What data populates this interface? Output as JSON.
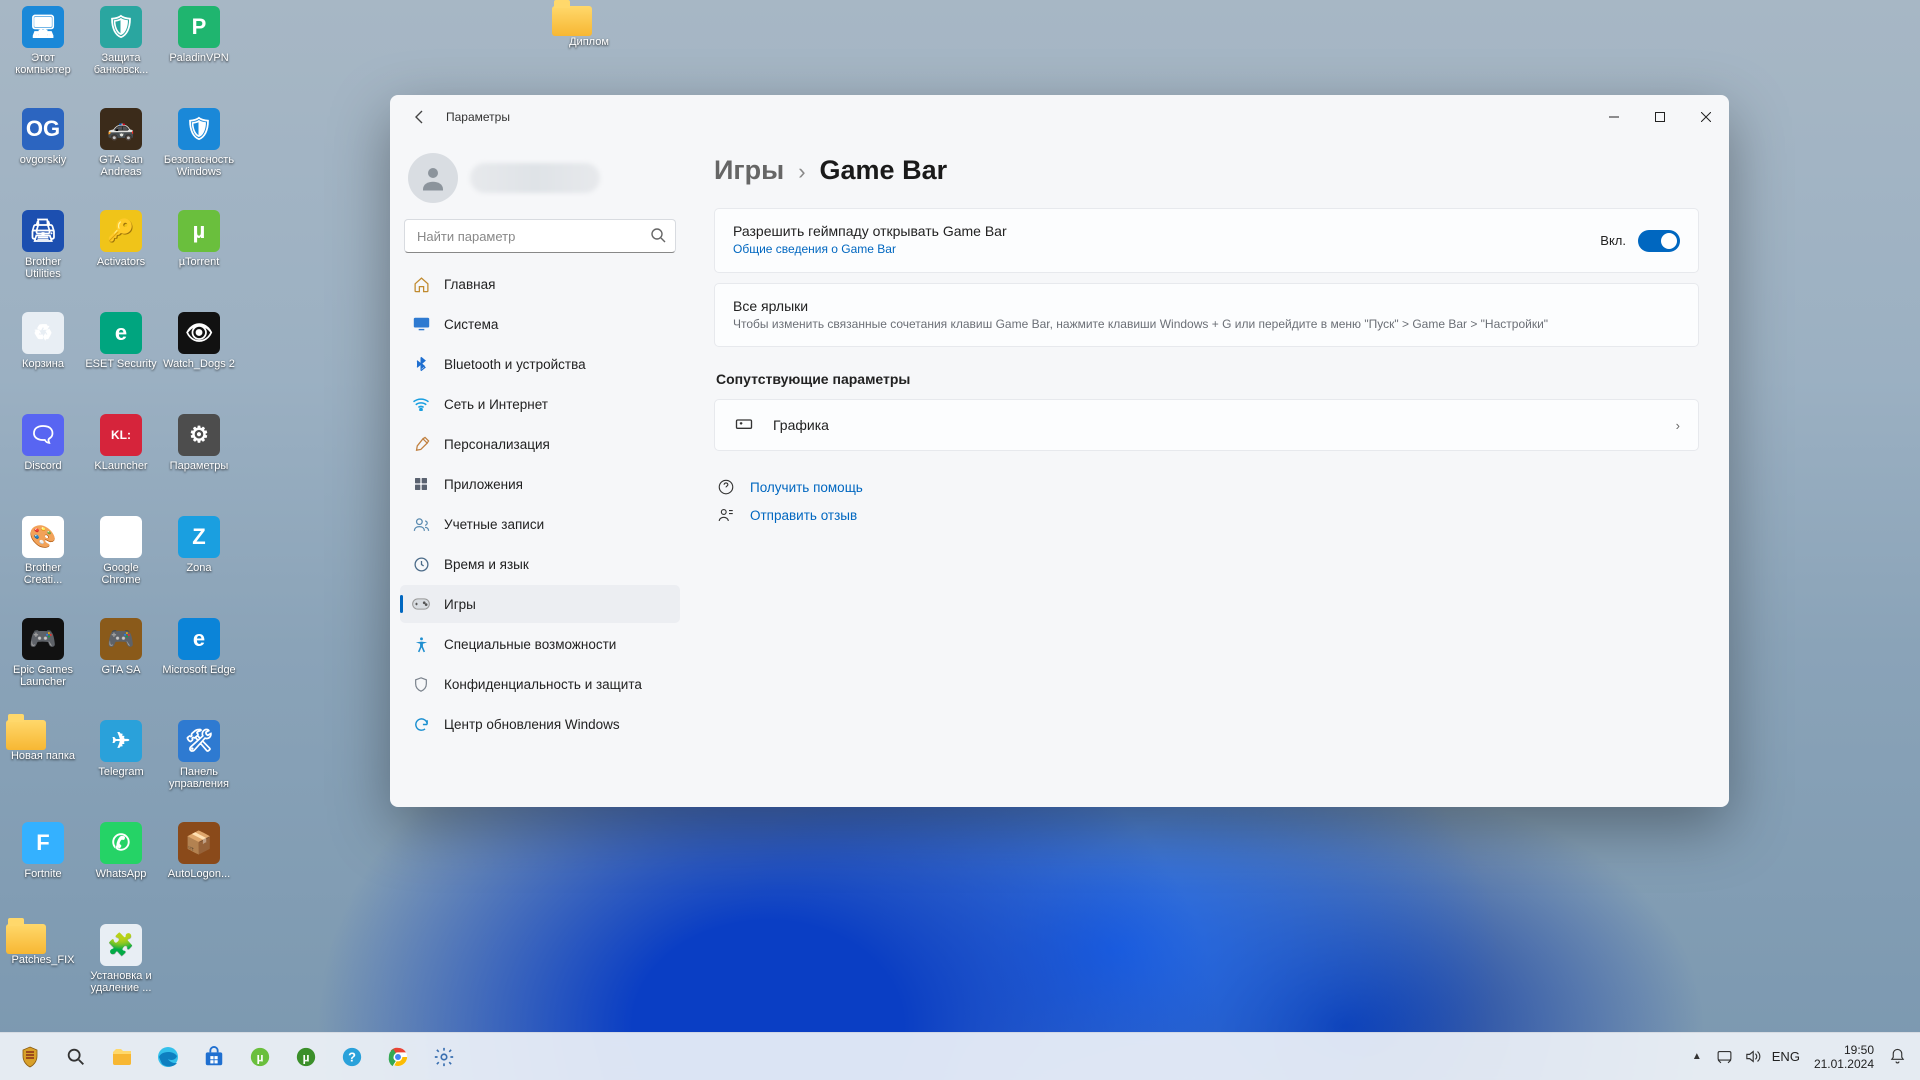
{
  "desktop_icons": [
    {
      "label": "Этот компьютер",
      "bg": "#1a88d8",
      "glyph": "🖥"
    },
    {
      "label": "ovgorskiy",
      "bg": "#2c65c0",
      "glyph": "OG"
    },
    {
      "label": "Brother Utilities",
      "bg": "#1c4fb0",
      "glyph": "🖨"
    },
    {
      "label": "Корзина",
      "bg": "#e8eef4",
      "glyph": "♻"
    },
    {
      "label": "Discord",
      "bg": "#5865f2",
      "glyph": "🗨"
    },
    {
      "label": "Brother Creati...",
      "bg": "#ffffff",
      "glyph": "🎨"
    },
    {
      "label": "Epic Games Launcher",
      "bg": "#111",
      "glyph": "🎮"
    },
    {
      "label": "Новая папка",
      "bg": "",
      "glyph": "folder"
    },
    {
      "label": "Fortnite",
      "bg": "#34b1ff",
      "glyph": "F"
    },
    {
      "label": "Patches_FIX",
      "bg": "",
      "glyph": "folder"
    },
    {
      "label": "Защита банковск...",
      "bg": "#2aa6a0",
      "glyph": "🛡"
    },
    {
      "label": "GTA San Andreas",
      "bg": "#3b2b1a",
      "glyph": "🚓"
    },
    {
      "label": "Activators",
      "bg": "#f0c419",
      "glyph": "🔑"
    },
    {
      "label": "ESET Security",
      "bg": "#00a57f",
      "glyph": "e"
    },
    {
      "label": "KLauncher",
      "bg": "#d6243b",
      "glyph": "KL:"
    },
    {
      "label": "Google Chrome",
      "bg": "#ffffff",
      "glyph": "◉"
    },
    {
      "label": "GTA SA",
      "bg": "#8a5a1a",
      "glyph": "🎮"
    },
    {
      "label": "Telegram",
      "bg": "#2aa1da",
      "glyph": "✈"
    },
    {
      "label": "WhatsApp",
      "bg": "#25d366",
      "glyph": "✆"
    },
    {
      "label": "Установка и удаление ...",
      "bg": "#e8eef4",
      "glyph": "🧩"
    },
    {
      "label": "PaladinVPN",
      "bg": "#1fb56f",
      "glyph": "P"
    },
    {
      "label": "Безопасность Windows",
      "bg": "#1a88d8",
      "glyph": "🛡"
    },
    {
      "label": "µTorrent",
      "bg": "#6abf3d",
      "glyph": "µ"
    },
    {
      "label": "Watch_Dogs 2",
      "bg": "#111",
      "glyph": "👁"
    },
    {
      "label": "Параметры",
      "bg": "#4d4d4d",
      "glyph": "⚙"
    },
    {
      "label": "Zona",
      "bg": "#1a9fe0",
      "glyph": "Z"
    },
    {
      "label": "Microsoft Edge",
      "bg": "#0b84d8",
      "glyph": "e"
    },
    {
      "label": "Панель управления",
      "bg": "#2e7ad1",
      "glyph": "🛠"
    },
    {
      "label": "AutoLogon...",
      "bg": "#8a4a1a",
      "glyph": "📦"
    },
    {
      "label": "Диплом",
      "bg": "",
      "glyph": "folder",
      "col": 7,
      "row": 0
    }
  ],
  "window": {
    "title": "Параметры",
    "search_placeholder": "Найти параметр",
    "breadcrumb_parent": "Игры",
    "breadcrumb_current": "Game Bar",
    "toggle_state_label": "Вкл.",
    "related_heading": "Сопутствующие параметры",
    "card_gamepad": {
      "title": "Разрешить геймпаду открывать Game Bar",
      "link": "Общие сведения о Game Bar"
    },
    "card_shortcuts": {
      "title": "Все ярлыки",
      "sub": "Чтобы изменить связанные сочетания клавиш Game Bar, нажмите клавиши Windows + G или перейдите в меню \"Пуск\" > Game Bar > \"Настройки\""
    },
    "row_graphics": "Графика",
    "link_help": "Получить помощь",
    "link_feedback": "Отправить отзыв"
  },
  "nav": {
    "items": [
      {
        "label": "Главная",
        "ico": "home"
      },
      {
        "label": "Система",
        "ico": "system"
      },
      {
        "label": "Bluetooth и устройства",
        "ico": "bluetooth"
      },
      {
        "label": "Сеть и Интернет",
        "ico": "wifi"
      },
      {
        "label": "Персонализация",
        "ico": "brush"
      },
      {
        "label": "Приложения",
        "ico": "apps"
      },
      {
        "label": "Учетные записи",
        "ico": "accounts"
      },
      {
        "label": "Время и язык",
        "ico": "time"
      },
      {
        "label": "Игры",
        "ico": "gaming",
        "active": true
      },
      {
        "label": "Специальные возможности",
        "ico": "access"
      },
      {
        "label": "Конфиденциальность и защита",
        "ico": "privacy"
      },
      {
        "label": "Центр обновления Windows",
        "ico": "update"
      }
    ]
  },
  "tray": {
    "lang": "ENG",
    "time": "19:50",
    "date": "21.01.2024"
  }
}
